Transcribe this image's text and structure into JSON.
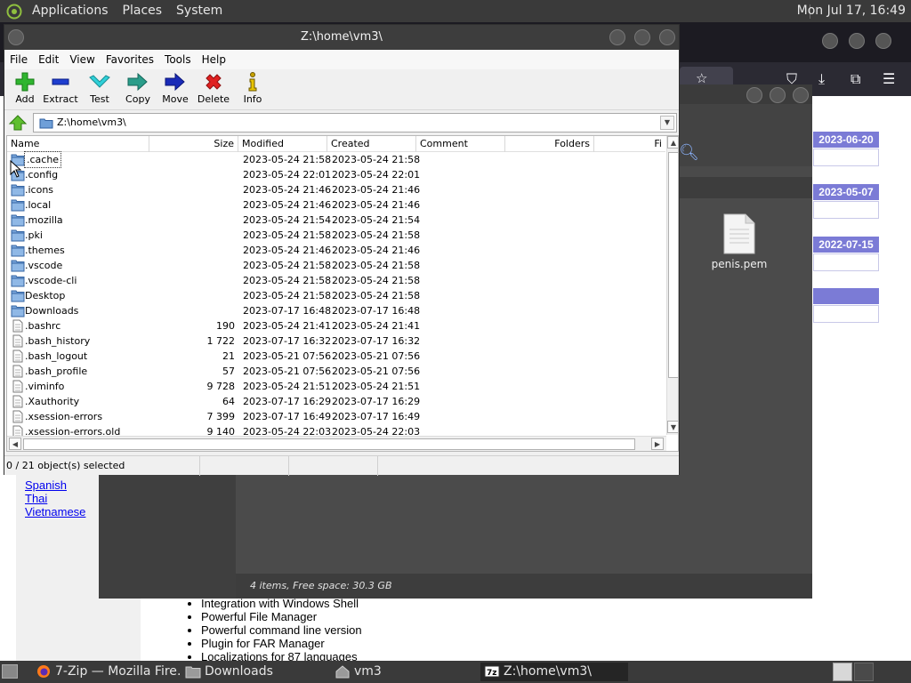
{
  "top_panel": {
    "menus": [
      "Applications",
      "Places",
      "System"
    ],
    "clock": "Mon Jul 17, 16:49"
  },
  "firefox": {
    "language_links": [
      "Spanish",
      "Thai",
      "Vietnamese"
    ],
    "news_dates": [
      "2023-06-20",
      "2023-05-07",
      "2022-07-15",
      ""
    ],
    "features": [
      "Integration with Windows Shell",
      "Powerful File Manager",
      "Powerful command line version",
      "Plugin for FAR Manager",
      "Localizations for 87 languages"
    ]
  },
  "file_manager": {
    "file_label": "penis.pem",
    "status": "4 items, Free space: 30.3 GB"
  },
  "zip": {
    "title": "Z:\\home\\vm3\\",
    "menu": [
      "File",
      "Edit",
      "View",
      "Favorites",
      "Tools",
      "Help"
    ],
    "toolbar": [
      {
        "id": "add",
        "label": "Add"
      },
      {
        "id": "extract",
        "label": "Extract"
      },
      {
        "id": "test",
        "label": "Test"
      },
      {
        "id": "copy",
        "label": "Copy"
      },
      {
        "id": "move",
        "label": "Move"
      },
      {
        "id": "delete",
        "label": "Delete"
      },
      {
        "id": "info",
        "label": "Info"
      }
    ],
    "path": "Z:\\home\\vm3\\",
    "columns": [
      "Name",
      "Size",
      "Modified",
      "Created",
      "Comment",
      "Folders",
      "Fi"
    ],
    "rows": [
      {
        "name": ".cache",
        "type": "folder",
        "size": "",
        "modified": "2023-05-24 21:58",
        "created": "2023-05-24 21:58"
      },
      {
        "name": ".config",
        "type": "folder",
        "size": "",
        "modified": "2023-05-24 22:01",
        "created": "2023-05-24 22:01"
      },
      {
        "name": ".icons",
        "type": "folder",
        "size": "",
        "modified": "2023-05-24 21:46",
        "created": "2023-05-24 21:46"
      },
      {
        "name": ".local",
        "type": "folder",
        "size": "",
        "modified": "2023-05-24 21:46",
        "created": "2023-05-24 21:46"
      },
      {
        "name": ".mozilla",
        "type": "folder",
        "size": "",
        "modified": "2023-05-24 21:54",
        "created": "2023-05-24 21:54"
      },
      {
        "name": ".pki",
        "type": "folder",
        "size": "",
        "modified": "2023-05-24 21:58",
        "created": "2023-05-24 21:58"
      },
      {
        "name": ".themes",
        "type": "folder",
        "size": "",
        "modified": "2023-05-24 21:46",
        "created": "2023-05-24 21:46"
      },
      {
        "name": ".vscode",
        "type": "folder",
        "size": "",
        "modified": "2023-05-24 21:58",
        "created": "2023-05-24 21:58"
      },
      {
        "name": ".vscode-cli",
        "type": "folder",
        "size": "",
        "modified": "2023-05-24 21:58",
        "created": "2023-05-24 21:58"
      },
      {
        "name": "Desktop",
        "type": "folder",
        "size": "",
        "modified": "2023-05-24 21:58",
        "created": "2023-05-24 21:58"
      },
      {
        "name": "Downloads",
        "type": "folder",
        "size": "",
        "modified": "2023-07-17 16:48",
        "created": "2023-07-17 16:48"
      },
      {
        "name": ".bashrc",
        "type": "file",
        "size": "190",
        "modified": "2023-05-24 21:41",
        "created": "2023-05-24 21:41"
      },
      {
        "name": ".bash_history",
        "type": "file",
        "size": "1 722",
        "modified": "2023-07-17 16:32",
        "created": "2023-07-17 16:32"
      },
      {
        "name": ".bash_logout",
        "type": "file",
        "size": "21",
        "modified": "2023-05-21 07:56",
        "created": "2023-05-21 07:56"
      },
      {
        "name": ".bash_profile",
        "type": "file",
        "size": "57",
        "modified": "2023-05-21 07:56",
        "created": "2023-05-21 07:56"
      },
      {
        "name": ".viminfo",
        "type": "file",
        "size": "9 728",
        "modified": "2023-05-24 21:51",
        "created": "2023-05-24 21:51"
      },
      {
        "name": ".Xauthority",
        "type": "file",
        "size": "64",
        "modified": "2023-07-17 16:29",
        "created": "2023-07-17 16:29"
      },
      {
        "name": ".xsession-errors",
        "type": "file",
        "size": "7 399",
        "modified": "2023-07-17 16:49",
        "created": "2023-07-17 16:49"
      },
      {
        "name": ".xsession-errors.old",
        "type": "file",
        "size": "9 140",
        "modified": "2023-05-24 22:03",
        "created": "2023-05-24 22:03"
      }
    ],
    "status": "0 / 21 object(s) selected"
  },
  "taskbar": {
    "tasks": [
      "7-Zip — Mozilla Fire…",
      "Downloads",
      "vm3",
      "Z:\\home\\vm3\\"
    ]
  }
}
